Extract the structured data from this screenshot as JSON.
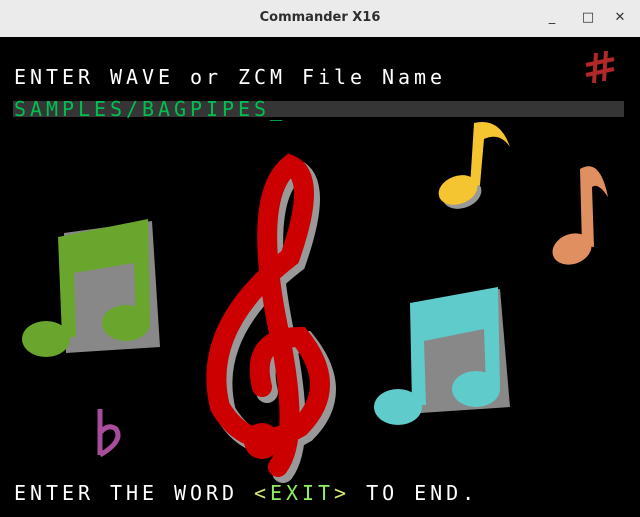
{
  "window": {
    "title": "Commander X16",
    "minimize": "_",
    "maximize": "□",
    "close": "✕"
  },
  "prompt": "ENTER WAVE or ZCM File Name",
  "file_input": {
    "value": "SAMPLES/BAGPIPES",
    "cursor": "_"
  },
  "footer": {
    "before": "ENTER THE WORD ",
    "lt": "<",
    "word": "EXIT",
    "gt": ">",
    "after": " TO END."
  },
  "colors": {
    "text": "#ffffff",
    "input_text": "#00c050",
    "input_bg": "#353535",
    "exit_word": "#90ee60",
    "brackets": "#d8e870"
  },
  "icons": [
    "sharp-icon",
    "flat-icon",
    "treble-clef-icon",
    "beamed-notes-green-icon",
    "beamed-notes-cyan-icon",
    "eighth-note-yellow-icon",
    "eighth-note-orange-icon"
  ]
}
